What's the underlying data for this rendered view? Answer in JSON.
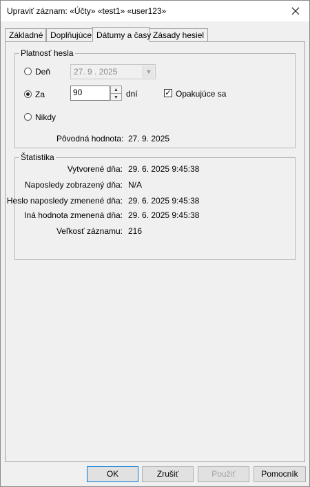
{
  "window": {
    "title": "Upraviť záznam:  «Účty» «test1» «user123»"
  },
  "tabs": [
    {
      "label": "Základné",
      "active": false
    },
    {
      "label": "Doplňujúce",
      "active": false
    },
    {
      "label": "Dátumy a časy",
      "active": true
    },
    {
      "label": "Zásady hesiel",
      "active": false
    }
  ],
  "password_validity": {
    "group_title": "Platnosť hesla",
    "option_day_label": "Deň",
    "day_value": "27.  9 . 2025",
    "option_in_label": "Za",
    "in_value": "90",
    "days_unit": "dní",
    "repeat_label": "Opakujúce sa",
    "repeat_checked": true,
    "option_never_label": "Nikdy",
    "selected_option": "in",
    "original_label": "Pôvodná hodnota:",
    "original_value": "27. 9. 2025"
  },
  "statistics": {
    "group_title": "Štatistika",
    "rows": [
      {
        "label": "Vytvorené dňa:",
        "value": "29. 6. 2025 9:45:38"
      },
      {
        "label": "Naposledy zobrazený dňa:",
        "value": "N/A"
      },
      {
        "label": "Heslo naposledy zmenené dňa:",
        "value": "29. 6. 2025 9:45:38"
      },
      {
        "label": "Iná hodnota zmenená dňa:",
        "value": "29. 6. 2025 9:45:38"
      },
      {
        "label": "Veľkosť záznamu:",
        "value": "216"
      }
    ]
  },
  "buttons": {
    "ok": "OK",
    "cancel": "Zrušiť",
    "apply": "Použiť",
    "help": "Pomocník"
  }
}
